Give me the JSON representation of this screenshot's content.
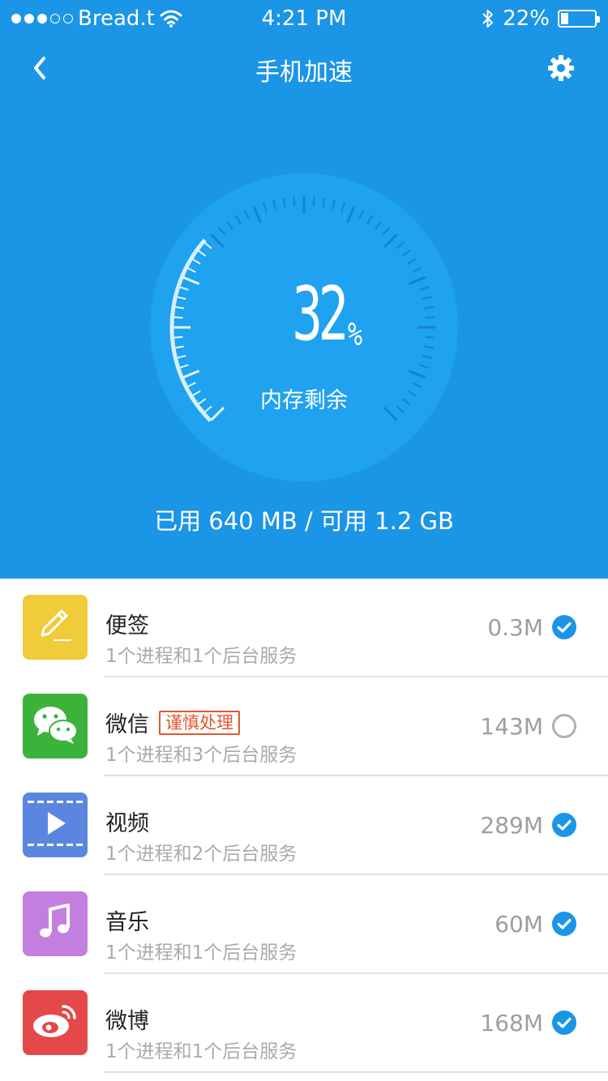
{
  "status_bar": {
    "carrier": "Bread.t",
    "time": "4:21 PM",
    "battery_pct_text": "22%",
    "battery_level": 0.22
  },
  "nav": {
    "title": "手机加速",
    "back_icon": "chevron-left-icon",
    "settings_icon": "gear-icon"
  },
  "gauge": {
    "value": "32",
    "unit": "%",
    "label": "内存剩余",
    "level": 0.32
  },
  "memory": {
    "summary": "已用 640 MB / 可用 1.2 GB"
  },
  "apps": [
    {
      "name": "便签",
      "tag": "",
      "desc": "1个进程和1个后台服务",
      "size": "0.3M",
      "checked": true,
      "icon": "note-pencil-icon",
      "color": "#f0cb3a"
    },
    {
      "name": "微信",
      "tag": "谨慎处理",
      "desc": "1个进程和3个后台服务",
      "size": "143M",
      "checked": false,
      "icon": "wechat-icon",
      "color": "#3bb33b"
    },
    {
      "name": "视频",
      "tag": "",
      "desc": "1个进程和2个后台服务",
      "size": "289M",
      "checked": true,
      "icon": "video-play-icon",
      "color": "#5b86e0"
    },
    {
      "name": "音乐",
      "tag": "",
      "desc": "1个进程和1个后台服务",
      "size": "60M",
      "checked": true,
      "icon": "music-note-icon",
      "color": "#c37fde"
    },
    {
      "name": "微博",
      "tag": "",
      "desc": "1个进程和1个后台服务",
      "size": "168M",
      "checked": true,
      "icon": "weibo-icon",
      "color": "#e44848"
    }
  ],
  "colors": {
    "primary": "#1b95e6",
    "check": "#1b95e6",
    "warning": "#e3582c"
  }
}
